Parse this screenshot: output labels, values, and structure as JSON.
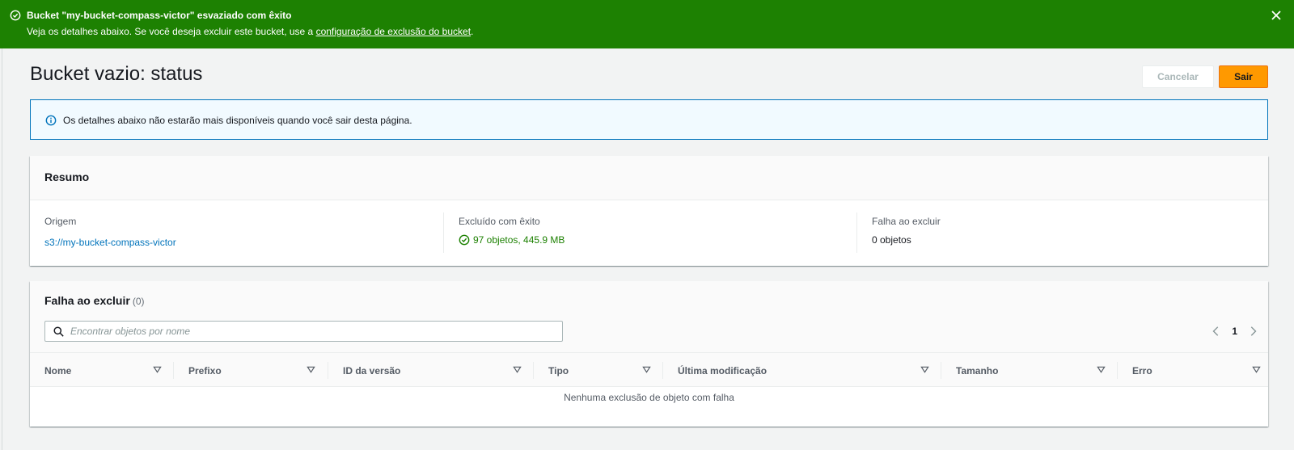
{
  "flash": {
    "title": "Bucket \"my-bucket-compass-victor\" esvaziado com êxito",
    "message_prefix": "Veja os detalhes abaixo. Se você deseja excluir este bucket, use a ",
    "link": "configuração de exclusão do bucket",
    "message_suffix": ".",
    "icons": {
      "status": "check-circle-icon",
      "close": "close-icon"
    },
    "color": "#1d8102"
  },
  "header": {
    "title": "Bucket vazio: status",
    "cancel_label": "Cancelar",
    "exit_label": "Sair"
  },
  "info": {
    "text": "Os detalhes abaixo não estarão mais disponíveis quando você sair desta página.",
    "icon": "info-icon"
  },
  "summary": {
    "title": "Resumo",
    "origin": {
      "label": "Origem",
      "value": "s3://my-bucket-compass-victor"
    },
    "succeeded": {
      "label": "Excluído com êxito",
      "value": "97 objetos, 445.9 MB"
    },
    "failed": {
      "label": "Falha ao excluir",
      "value": "0 objetos"
    }
  },
  "failed_table": {
    "title": "Falha ao excluir",
    "count": "(0)",
    "search_placeholder": "Encontrar objetos por nome",
    "page": "1",
    "columns": [
      "Nome",
      "Prefixo",
      "ID da versão",
      "Tipo",
      "Última modificação",
      "Tamanho",
      "Erro"
    ],
    "empty_text": "Nenhuma exclusão de objeto com falha"
  },
  "colors": {
    "accent": "#ff9900",
    "link": "#0073bb",
    "success": "#1d8102"
  }
}
